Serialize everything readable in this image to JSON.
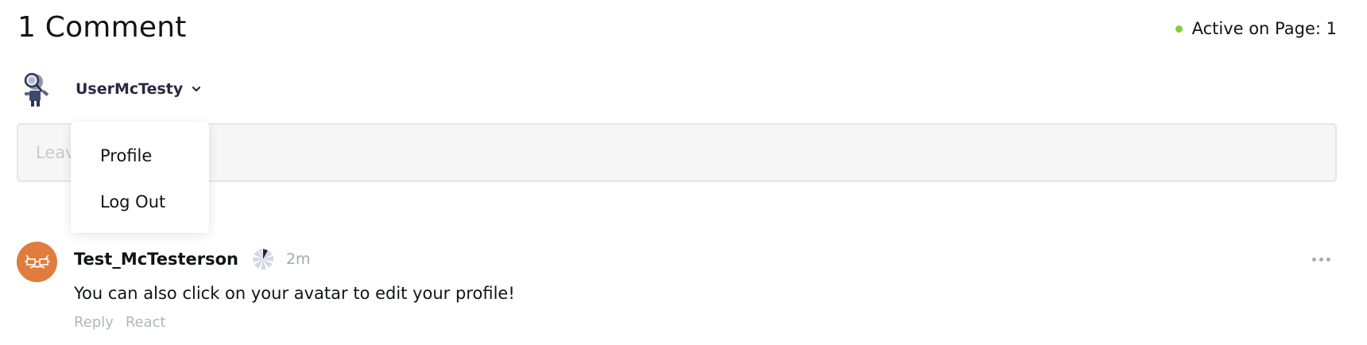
{
  "header": {
    "comment_count": "1 Comment",
    "active_status": "Active on Page: 1",
    "active_color": "#7bd23c"
  },
  "current_user": {
    "name": "UserMcTesty",
    "avatar_icon": "magnifier-robot-avatar-icon",
    "dropdown_icon": "chevron-down-icon"
  },
  "input": {
    "placeholder": "Leave a comment"
  },
  "user_menu": {
    "items": [
      {
        "label": "Profile"
      },
      {
        "label": "Log Out"
      }
    ]
  },
  "comments": [
    {
      "author": "Test_McTesterson",
      "avatar_color": "#e07c3d",
      "avatar_icon": "mustache-glasses-avatar-icon",
      "badge_icon": "pinwheel-badge-icon",
      "time": "2m",
      "body": "You can also click on your avatar to edit your profile!",
      "actions": [
        "Reply",
        "React"
      ],
      "more_icon": "more-options-icon"
    }
  ]
}
